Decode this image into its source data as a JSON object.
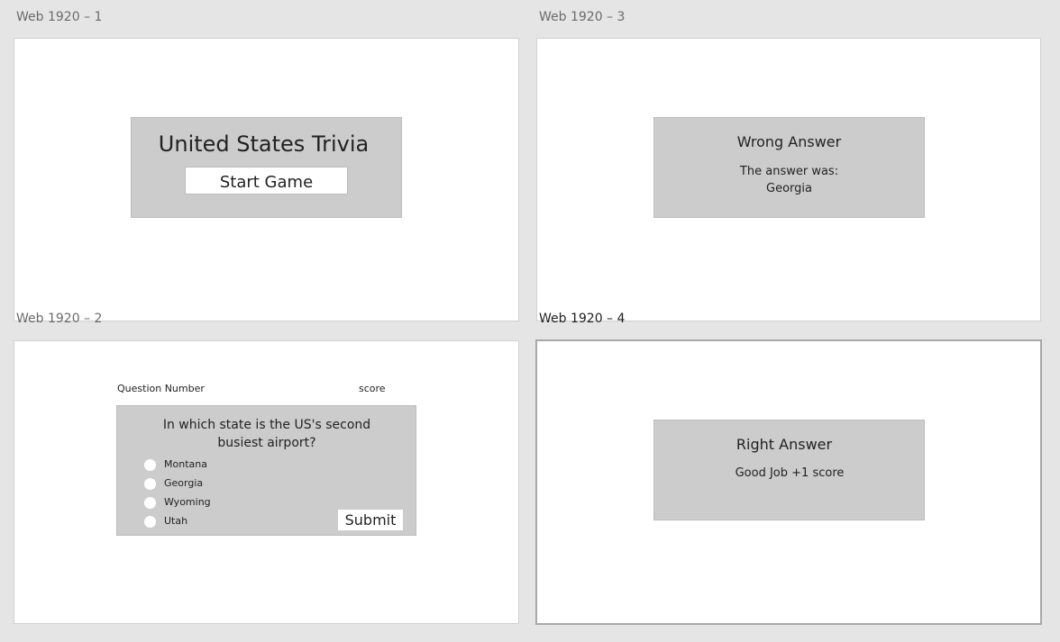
{
  "artboards": {
    "a1": {
      "label": "Web 1920 – 1",
      "title": "United States Trivia",
      "start_button": "Start Game"
    },
    "a3": {
      "label": "Web 1920 – 3",
      "title": "Wrong Answer",
      "line1": "The answer was:",
      "line2": "Georgia"
    },
    "a2": {
      "label": "Web 1920 – 2",
      "question_number": "Question Number",
      "score": "score",
      "question_line1": "In which state is the US's second",
      "question_line2": "busiest airport?",
      "options": [
        "Montana",
        "Georgia",
        "Wyoming",
        "Utah"
      ],
      "submit": "Submit"
    },
    "a4": {
      "label": "Web 1920 – 4",
      "title": "Right Answer",
      "message": "Good Job +1 score"
    }
  }
}
